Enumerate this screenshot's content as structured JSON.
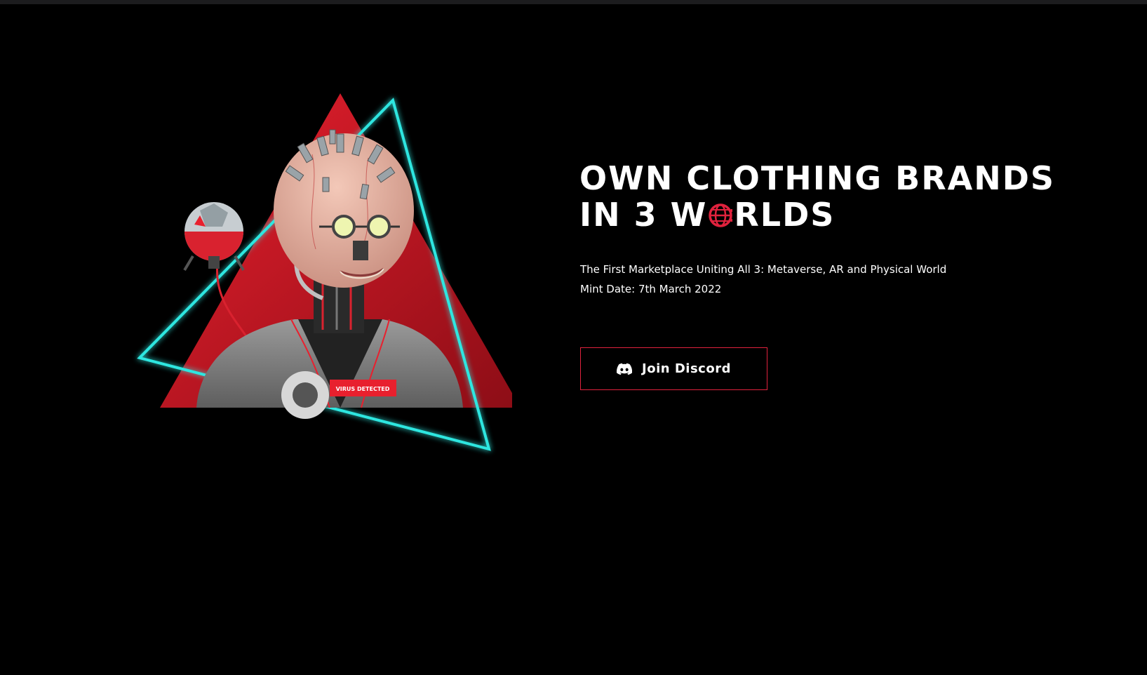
{
  "hero": {
    "headline_line1": "OWN CLOTHING BRANDS",
    "headline_line2_before": "IN 3 W",
    "headline_line2_icon": "globe-network-icon",
    "headline_line2_after": "RLDS",
    "tagline": "The First Marketplace Uniting All 3: Metaverse, AR and Physical World",
    "mint_date": "Mint Date: 7th March 2022",
    "art_label": "VIRUS DETECTED"
  },
  "cta": {
    "label": "Join Discord",
    "icon": "discord-icon"
  },
  "colors": {
    "background": "#000000",
    "accent_red": "#e0223d",
    "neon_cyan": "#2ee6e0",
    "text": "#ffffff"
  }
}
